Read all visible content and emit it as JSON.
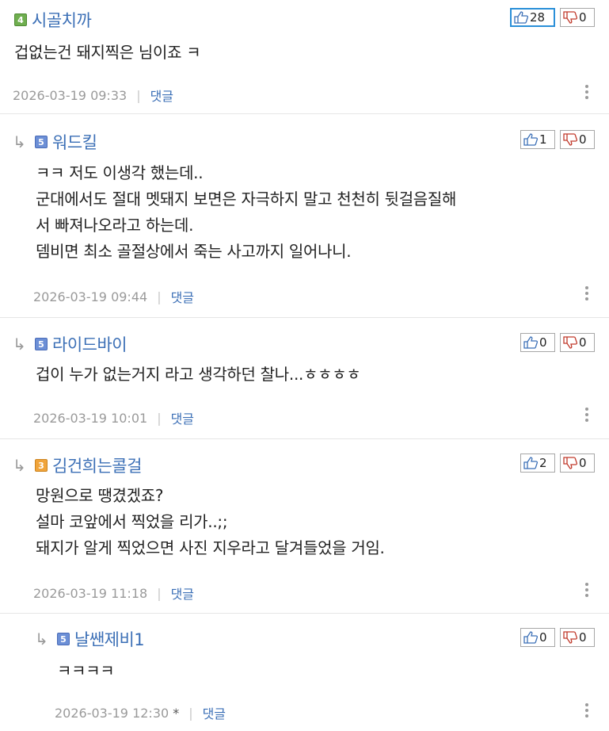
{
  "comments": [
    {
      "level": "4",
      "level_color": "#6fae4f",
      "nickname": "시골치까",
      "up": "28",
      "down": "0",
      "up_active": true,
      "lines": [
        "겁없는건  돼지찍은 님이죠 ㅋ"
      ],
      "date": "2026-03-19 09:33",
      "reply_label": "댓글"
    },
    {
      "level": "5",
      "level_color": "#6c8fd6",
      "nickname": "워드킬",
      "up": "1",
      "down": "0",
      "lines": [
        "ㅋㅋ 저도 이생각 했는데..",
        "군대에서도 절대 멧돼지 보면은 자극하지 말고 천천히 뒷걸음질해",
        "서 빠져나오라고 하는데.",
        "뎀비면 최소 골절상에서 죽는 사고까지 일어나니."
      ],
      "date": "2026-03-19 09:44",
      "reply_label": "댓글"
    },
    {
      "level": "5",
      "level_color": "#6c8fd6",
      "nickname": "라이드바이",
      "up": "0",
      "down": "0",
      "lines": [
        "겁이 누가 없는거지 라고 생각하던 찰나...ㅎㅎㅎㅎ"
      ],
      "date": "2026-03-19 10:01",
      "reply_label": "댓글"
    },
    {
      "level": "3",
      "level_color": "#f0a43a",
      "nickname": "김건희는콜걸",
      "up": "2",
      "down": "0",
      "lines": [
        "망원으로 땡겼겠죠?",
        "설마 코앞에서 찍었을 리가..;;",
        "돼지가 알게 찍었으면 사진 지우라고 달겨들었을 거임."
      ],
      "date": "2026-03-19 11:18",
      "reply_label": "댓글"
    },
    {
      "level": "5",
      "level_color": "#6c8fd6",
      "nickname": "날쌘제비1",
      "up": "0",
      "down": "0",
      "lines": [
        "ㅋㅋㅋㅋ"
      ],
      "date": "2026-03-19 12:30",
      "edited_mark": "*",
      "reply_label": "댓글"
    }
  ]
}
